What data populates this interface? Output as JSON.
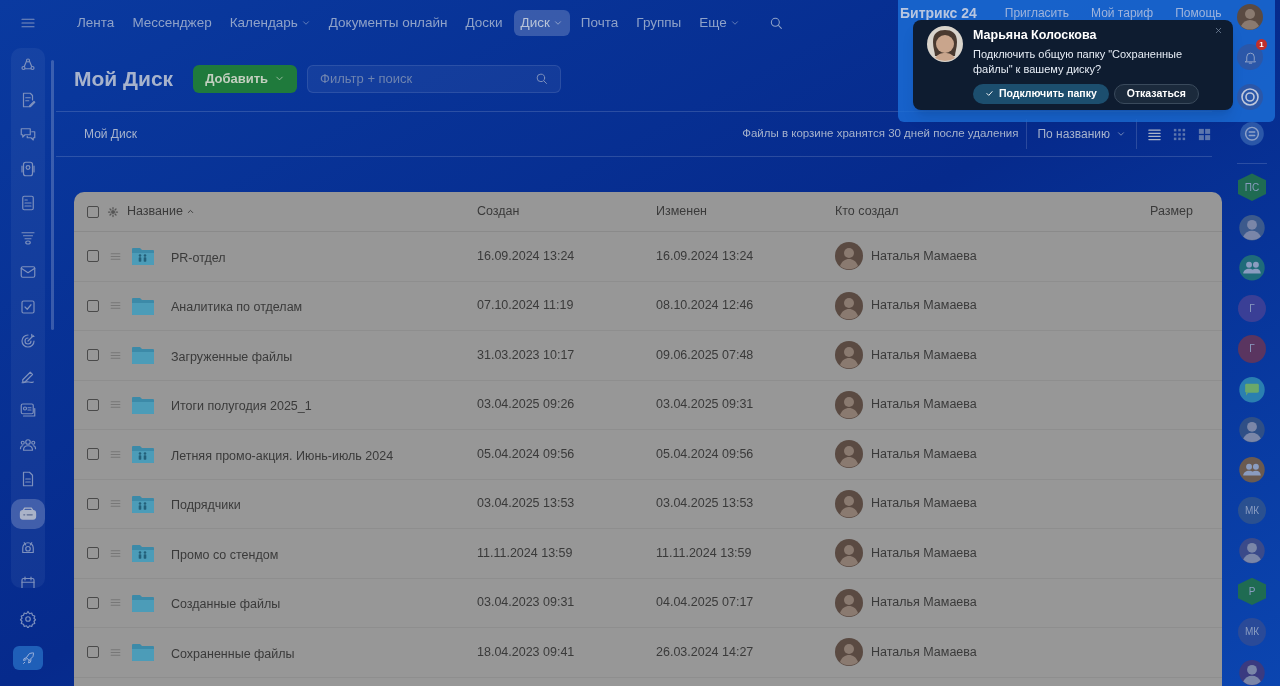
{
  "top_nav": {
    "items": [
      {
        "label": "Лента",
        "has_menu": false,
        "selected": false
      },
      {
        "label": "Мессенджер",
        "has_menu": false,
        "selected": false
      },
      {
        "label": "Календарь",
        "has_menu": true,
        "selected": false
      },
      {
        "label": "Документы онлайн",
        "has_menu": false,
        "selected": false
      },
      {
        "label": "Доски",
        "has_menu": false,
        "selected": false
      },
      {
        "label": "Диск",
        "has_menu": true,
        "selected": true
      },
      {
        "label": "Почта",
        "has_menu": false,
        "selected": false
      },
      {
        "label": "Группы",
        "has_menu": false,
        "selected": false
      },
      {
        "label": "Еще",
        "has_menu": true,
        "selected": false
      }
    ],
    "logo": "Битрикс 24",
    "header_links": [
      "Пригласить",
      "Мой тариф",
      "Помощь"
    ],
    "notification_count": "1"
  },
  "left_sidebar": {
    "items": [
      {
        "selected": false
      },
      {
        "selected": false
      },
      {
        "selected": false
      },
      {
        "selected": false
      },
      {
        "selected": false
      },
      {
        "selected": false
      },
      {
        "selected": false
      },
      {
        "selected": false
      },
      {
        "selected": false
      },
      {
        "selected": false
      },
      {
        "selected": false
      },
      {
        "selected": false
      },
      {
        "selected": false
      },
      {
        "selected": true
      },
      {
        "selected": false
      },
      {
        "selected": false
      }
    ]
  },
  "toolbar": {
    "title": "Мой Диск",
    "add_button": "Добавить",
    "search": {
      "placeholder": "Фильтр + поиск"
    }
  },
  "breadcrumb": "Мой Диск",
  "trash_note": "Файлы в корзине хранятся 30 дней после удаления",
  "sort": "По названию",
  "views": [
    {
      "kind": "list",
      "selected": true
    },
    {
      "kind": "grid",
      "selected": false
    },
    {
      "kind": "tiles",
      "selected": false
    }
  ],
  "table": {
    "all_checked": false,
    "columns": [
      {
        "label": "Название",
        "sorted": true
      },
      {
        "label": "Создан",
        "sorted": false
      },
      {
        "label": "Изменен",
        "sorted": false
      },
      {
        "label": "Кто создал",
        "sorted": false
      },
      {
        "label": "Размер",
        "sorted": false
      }
    ],
    "rows": [
      {
        "name": "PR-отдел",
        "kind": "shared",
        "created": "16.09.2024 13:24",
        "modified": "16.09.2024 13:24",
        "author": "Наталья Мамаева",
        "checked": false
      },
      {
        "name": "Аналитика по отделам",
        "kind": "folder",
        "created": "07.10.2024 11:19",
        "modified": "08.10.2024 12:46",
        "author": "Наталья Мамаева",
        "checked": false
      },
      {
        "name": "Загруженные файлы",
        "kind": "folder",
        "created": "31.03.2023 10:17",
        "modified": "09.06.2025 07:48",
        "author": "Наталья Мамаева",
        "checked": false
      },
      {
        "name": "Итоги полугодия 2025_1",
        "kind": "folder",
        "created": "03.04.2025 09:26",
        "modified": "03.04.2025 09:31",
        "author": "Наталья Мамаева",
        "checked": false
      },
      {
        "name": "Летняя промо-акция. Июнь-июль 2024",
        "kind": "shared",
        "created": "05.04.2024 09:56",
        "modified": "05.04.2024 09:56",
        "author": "Наталья Мамаева",
        "checked": false
      },
      {
        "name": "Подрядчики",
        "kind": "shared",
        "created": "03.04.2025 13:53",
        "modified": "03.04.2025 13:53",
        "author": "Наталья Мамаева",
        "checked": false
      },
      {
        "name": "Промо со стендом",
        "kind": "shared",
        "created": "11.11.2024 13:59",
        "modified": "11.11.2024 13:59",
        "author": "Наталья Мамаева",
        "checked": false
      },
      {
        "name": "Созданные файлы",
        "kind": "folder",
        "created": "03.04.2023 09:31",
        "modified": "04.04.2025 07:17",
        "author": "Наталья Мамаева",
        "checked": false
      },
      {
        "name": "Сохраненные файлы",
        "kind": "folder",
        "created": "18.04.2023 09:41",
        "modified": "26.03.2024 14:27",
        "author": "Наталья Мамаева",
        "checked": false
      }
    ]
  },
  "right_sidebar": [
    {
      "kind": "initials",
      "label": "ПС",
      "hexagon": true,
      "color": "#1f6b52"
    },
    {
      "kind": "avatar",
      "color": "#3c5a8c"
    },
    {
      "kind": "group",
      "color": "#1f6b7a"
    },
    {
      "kind": "initials",
      "label": "Г",
      "hexagon": false,
      "color": "#3a3f96"
    },
    {
      "kind": "initials",
      "label": "Г",
      "hexagon": false,
      "color": "#5a3560"
    },
    {
      "kind": "chat",
      "color": "#2a7fb0"
    },
    {
      "kind": "avatar",
      "color": "#2f4f86"
    },
    {
      "kind": "group",
      "color": "#6a5a50"
    },
    {
      "kind": "initials",
      "label": "МК",
      "hexagon": false,
      "color": "#2a5090"
    },
    {
      "kind": "avatar",
      "color": "#3a4a8a"
    },
    {
      "kind": "initials",
      "label": "Р",
      "hexagon": true,
      "color": "#1f6b52"
    },
    {
      "kind": "initials",
      "label": "МК",
      "hexagon": false,
      "color": "#2a4a98"
    },
    {
      "kind": "avatar",
      "color": "#3a3a80"
    }
  ],
  "popup": {
    "author": "Марьяна Колоскова",
    "message": "Подключить общую папку \"Сохраненные файлы\" к вашему диску?",
    "buttons": [
      {
        "label": "Подключить папку",
        "kind": "primary"
      },
      {
        "label": "Отказаться",
        "kind": "secondary"
      }
    ]
  }
}
